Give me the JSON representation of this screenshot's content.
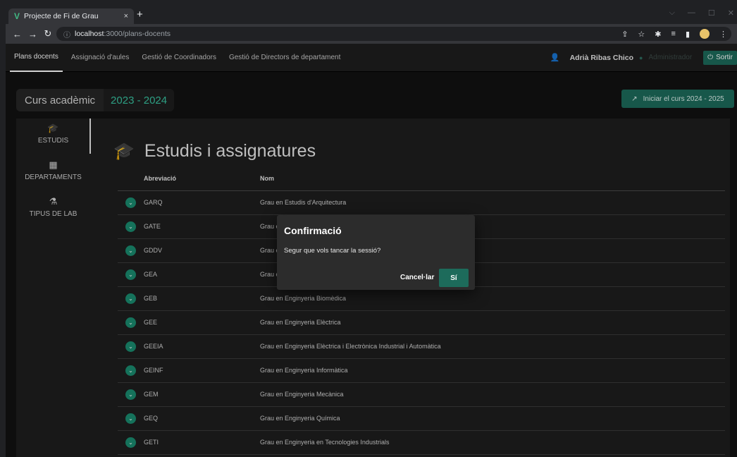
{
  "browser": {
    "tab_title": "Projecte de Fi de Grau",
    "tab_close": "×",
    "new_tab": "+",
    "url_host": "localhost",
    "url_path": ":3000/plans-docents"
  },
  "appbar": {
    "nav": [
      "Plans docents",
      "Assignació d'aules",
      "Gestió de Coordinadors",
      "Gestió de Directors de departament"
    ],
    "user_name": "Adrià Ribas Chico",
    "role": "Administrador",
    "logout_label": "Sortir"
  },
  "curs": {
    "label": "Curs acadèmic",
    "year": "2023 - 2024",
    "start_button": "Iniciar el curs 2024 - 2025"
  },
  "sidenav": {
    "items": [
      {
        "label": "ESTUDIS",
        "icon": "graduation-cap-icon"
      },
      {
        "label": "DEPARTAMENTS",
        "icon": "building-icon"
      },
      {
        "label": "TIPUS DE LAB",
        "icon": "flask-icon"
      }
    ]
  },
  "content": {
    "title": "Estudis i assignatures",
    "columns": [
      "Abreviació",
      "Nom"
    ],
    "rows": [
      {
        "abr": "GARQ",
        "nom": "Grau en Estudis d'Arquitectura"
      },
      {
        "abr": "GATE",
        "nom": "Grau e"
      },
      {
        "abr": "GDDV",
        "nom": "Grau e"
      },
      {
        "abr": "GEA",
        "nom": "Grau e"
      },
      {
        "abr": "GEB",
        "nom": "Grau en Enginyeria Biomèdica"
      },
      {
        "abr": "GEE",
        "nom": "Grau en Enginyeria Elèctrica"
      },
      {
        "abr": "GEEIA",
        "nom": "Grau en Enginyeria Elèctrica i Electrònica Industrial i Automàtica"
      },
      {
        "abr": "GEINF",
        "nom": "Grau en Enginyeria Informàtica"
      },
      {
        "abr": "GEM",
        "nom": "Grau en Enginyeria Mecànica"
      },
      {
        "abr": "GEQ",
        "nom": "Grau en Enginyeria Química"
      },
      {
        "abr": "GETI",
        "nom": "Grau en Enginyeria en Tecnologies Industrials"
      }
    ]
  },
  "dialog": {
    "title": "Confirmació",
    "message": "Segur que vols tancar la sessió?",
    "cancel": "Cancel·lar",
    "confirm": "Sí"
  },
  "colors": {
    "accent": "#1d6b5b",
    "accent_light": "#38c2a0"
  }
}
